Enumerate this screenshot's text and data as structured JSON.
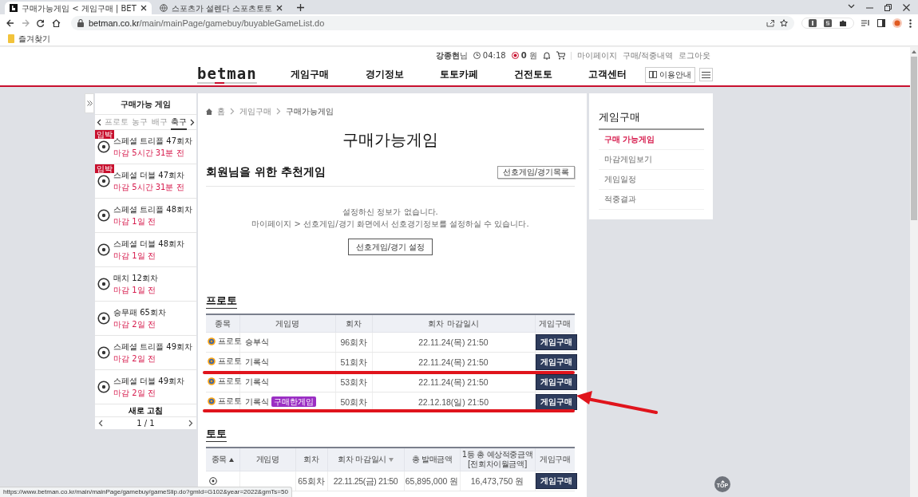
{
  "browser": {
    "tabs": [
      {
        "title": "구매가능게임 < 게임구매 | BET",
        "selected": true
      },
      {
        "title": "스포츠가 설렌다 스포츠토토",
        "selected": false
      }
    ],
    "url": {
      "host": "betman.co.kr",
      "path": "/main/mainPage/gamebuy/buyableGameList.do"
    },
    "bookmarks": [
      "즐겨찾기"
    ]
  },
  "header": {
    "user": {
      "name": "강종현",
      "suffix": "님"
    },
    "timer": "04:18",
    "points": "0",
    "points_unit": "원",
    "links": [
      "마이페이지",
      "구매/적중내역",
      "로그아웃"
    ],
    "logo": "betman",
    "nav": [
      "게임구매",
      "경기정보",
      "토토카페",
      "건전토토",
      "고객센터"
    ],
    "guide_button": "이용안내"
  },
  "sidebar": {
    "title": "구매가능 게임",
    "sports": [
      {
        "label": "프로토",
        "selected": false
      },
      {
        "label": "농구",
        "selected": false
      },
      {
        "label": "배구",
        "selected": false
      },
      {
        "label": "축구",
        "selected": true
      }
    ],
    "games": [
      {
        "name": "스페셜 트리플 47회차",
        "deadline": "마감 5시간 31분 전",
        "badge": "임박"
      },
      {
        "name": "스페셜 더블 47회차",
        "deadline": "마감 5시간 31분 전",
        "badge": "임박"
      },
      {
        "name": "스페셜 트리플 48회차",
        "deadline": "마감 1일 전"
      },
      {
        "name": "스페셜 더블 48회차",
        "deadline": "마감 1일 전"
      },
      {
        "name": "매치 12회차",
        "deadline": "마감 1일 전"
      },
      {
        "name": "승무패 65회차",
        "deadline": "마감 2일 전"
      },
      {
        "name": "스페셜 트리플 49회차",
        "deadline": "마감 2일 전"
      },
      {
        "name": "스페셜 더블 49회차",
        "deadline": "마감 2일 전"
      }
    ],
    "refresh": "새로 고침",
    "pager": "1 / 1"
  },
  "breadcrumb": [
    "홈",
    "게임구매",
    "구매가능게임"
  ],
  "page_title": "구매가능게임",
  "recommend": {
    "title": "회원님을 위한 추천게임",
    "list_button": "선호게임/경기목록",
    "message": [
      "설정하신 정보가 없습니다.",
      "마이페이지 > 선호게임/경기 화면에서 선호경기정보를 설정하실 수 있습니다."
    ],
    "setup_button": "선호게임/경기 설정"
  },
  "proto": {
    "title": "프로토",
    "columns": [
      "종목",
      "게임명",
      "회차",
      "회차 마감일시",
      "게임구매"
    ],
    "rows": [
      {
        "sport": "프로토",
        "game": "승부식",
        "round": "96회차",
        "deadline": "22.11.24(목) 21:50",
        "button": "게임구매",
        "underlined": false,
        "arrow": false
      },
      {
        "sport": "프로토",
        "game": "기록식",
        "round": "51회차",
        "deadline": "22.11.24(목) 21:50",
        "button": "게임구매",
        "underlined": true,
        "arrow": false
      },
      {
        "sport": "프로토",
        "game": "기록식",
        "round": "53회차",
        "deadline": "22.11.24(목) 21:50",
        "button": "게임구매",
        "underlined": false,
        "arrow": false
      },
      {
        "sport": "프로토",
        "game": "기록식",
        "badge": "구매한게임",
        "round": "50회차",
        "deadline": "22.12.18(일) 21:50",
        "button": "게임구매",
        "underlined": true,
        "arrow": true
      }
    ]
  },
  "toto": {
    "title": "토토",
    "columns": [
      {
        "label": "종목",
        "sort_up": true,
        "sort_down": false
      },
      {
        "label": "게임명"
      },
      {
        "label": "회차"
      },
      {
        "label": "회차 마감일시",
        "sort_up": false,
        "sort_down": true
      },
      {
        "label": "총 발매금액"
      },
      {
        "label": "1등 총 예상적중금액",
        "note": "[전회차이월금액]"
      },
      {
        "label": "게임구매"
      }
    ],
    "rows": [
      {
        "round": "65회차",
        "deadline": "22.11.25(금) 21:50",
        "sales": "65,895,000 원",
        "expected": "16,473,750 원",
        "button": "게임구매"
      }
    ]
  },
  "menu": {
    "title": "게임구매",
    "items": [
      {
        "label": "구매 가능게임",
        "selected": true
      },
      {
        "label": "마감게임보기",
        "selected": false
      },
      {
        "label": "게임일정",
        "selected": false
      },
      {
        "label": "적중결과",
        "selected": false
      }
    ]
  },
  "status_url": "https://www.betman.co.kr/main/mainPage/gamebuy/gameSlip.do?gmId=G102&year=2022&gmTs=50",
  "top_button": "TOP"
}
